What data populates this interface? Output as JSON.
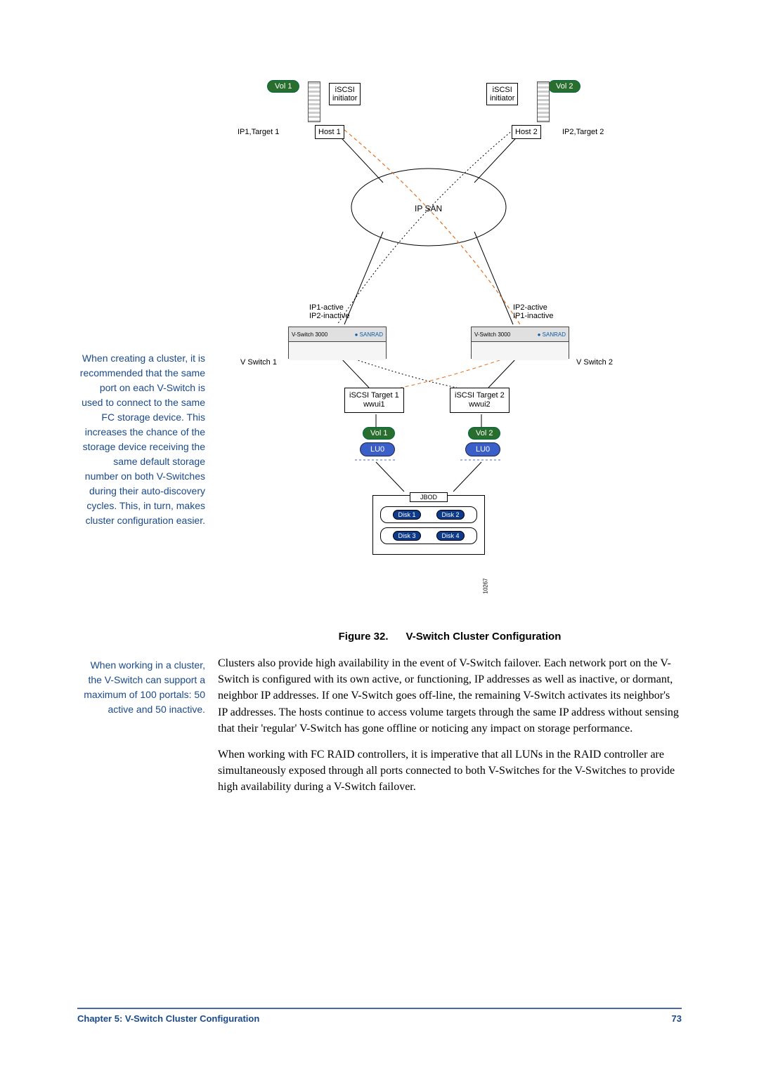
{
  "diagram": {
    "vol1": "Vol 1",
    "vol2": "Vol 2",
    "iscsi_initiator": "iSCSI\ninitiator",
    "host1": "Host 1",
    "host2": "Host 2",
    "ip1_target1": "IP1,Target 1",
    "ip2_target2": "IP2,Target 2",
    "ipsan": "IP SAN",
    "ip1_active": "IP1-active",
    "ip2_inactive": "IP2-inactive",
    "ip2_active": "IP2-active",
    "ip1_inactive": "IP1-inactive",
    "vswitch1": "V Switch 1",
    "vswitch2": "V Switch 2",
    "target1": "iSCSI Target 1",
    "wwui1": "wwui1",
    "target2": "iSCSI Target 2",
    "wwui2": "wwui2",
    "lu0": "LU0",
    "jbod": "JBOD",
    "disk1": "Disk 1",
    "disk2": "Disk 2",
    "disk3": "Disk 3",
    "disk4": "Disk 4",
    "fig_id": "10267"
  },
  "caption": {
    "label": "Figure 32.",
    "title": "V-Switch Cluster Configuration"
  },
  "sidenote1": "When creating a cluster, it is recommended that the same port on each V-Switch is used to connect to the same FC storage device.  This increases the chance of the storage device receiving the same default storage number on both V-Switches during their auto-discovery cycles.  This, in turn, makes cluster configuration easier.",
  "sidenote2": "When working in a cluster, the V-Switch can support a maximum of 100 portals:  50 active and 50 inactive.",
  "body": {
    "p1": "Clusters also provide high availability in the event of V-Switch failover.  Each network port on the V-Switch is configured with its own active, or functioning, IP addresses as well as inactive, or dormant, neighbor IP addresses.  If one V-Switch goes off-line, the remaining V-Switch activates its neighbor's IP addresses.  The hosts continue to access volume targets through the same IP address without sensing that their 'regular' V-Switch has gone offline or noticing any impact on storage performance.",
    "p2": "When working with FC RAID controllers, it is imperative that all LUNs in the RAID controller are simultaneously exposed through all ports connected to both V-Switches for the V-Switches to provide high availability during a V-Switch failover."
  },
  "footer": {
    "chapter": "Chapter 5:  V-Switch Cluster Configuration",
    "page": "73"
  }
}
